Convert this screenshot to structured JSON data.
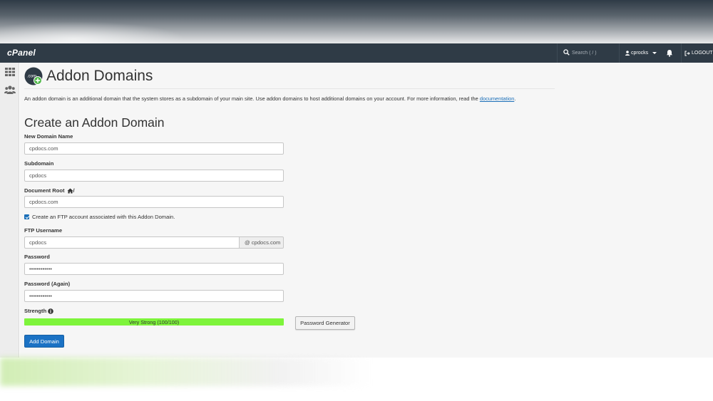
{
  "header": {
    "logo": "cPanel",
    "search_placeholder": "Search ( / )",
    "username": "cprocks",
    "logout_label": "LOGOUT"
  },
  "page": {
    "title": "Addon Domains",
    "intro_text": "An addon domain is an additional domain that the system stores as a subdomain of your main site. Use addon domains to host additional domains on your account. For more information, read the ",
    "intro_link": "documentation",
    "intro_end": "."
  },
  "form": {
    "section_title": "Create an Addon Domain",
    "new_domain_label": "New Domain Name",
    "new_domain_value": "cpdocs.com",
    "subdomain_label": "Subdomain",
    "subdomain_value": "cpdocs",
    "docroot_label": "Document Root",
    "docroot_suffix": "/",
    "docroot_value": "cpdocs.com",
    "ftp_checkbox_label": "Create an FTP account associated with this Addon Domain.",
    "ftp_checked": true,
    "ftp_username_label": "FTP Username",
    "ftp_username_value": "cpdocs",
    "ftp_domain_addon": "@ cpdocs.com",
    "password_label": "Password",
    "password_value": "••••••••••••",
    "password_again_label": "Password (Again)",
    "password_again_value": "••••••••••••",
    "strength_label": "Strength",
    "strength_text": "Very Strong (100/100)",
    "strength_score": 100,
    "password_generator_label": "Password Generator",
    "submit_label": "Add Domain"
  },
  "colors": {
    "topbar": "#2f3b46",
    "accent": "#1b72c4",
    "strength": "#7ef43b",
    "link": "#1b6fb8"
  },
  "icons": {
    "rail": [
      "grid-icon",
      "users-icon"
    ],
    "page": "addon-domain-icon"
  }
}
